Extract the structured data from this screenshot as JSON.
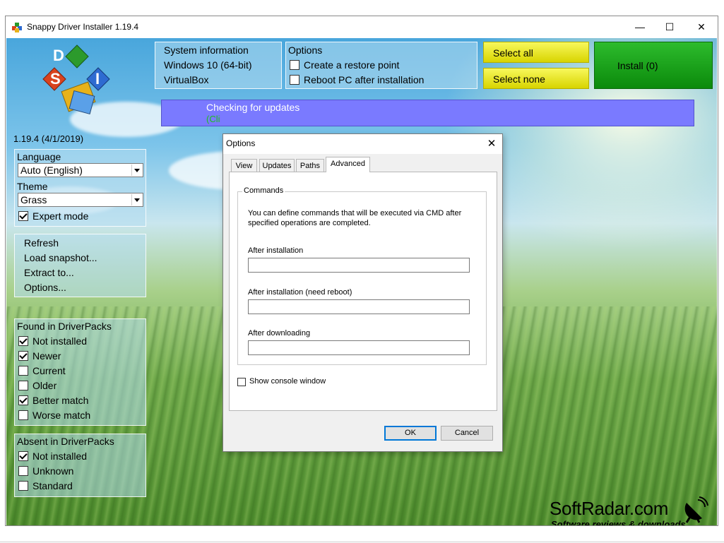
{
  "window": {
    "title": "Snappy Driver Installer 1.19.4",
    "minimize": "—",
    "maximize": "☐",
    "close": "✕"
  },
  "logo": {
    "letters": [
      "D",
      "S",
      "I"
    ],
    "version": "1.19.4 (4/1/2019)"
  },
  "settings": {
    "language_label": "Language",
    "language_value": "Auto (English)",
    "theme_label": "Theme",
    "theme_value": "Grass",
    "expert_mode": {
      "label": "Expert mode",
      "checked": true
    }
  },
  "actions": [
    "Refresh",
    "Load snapshot...",
    "Extract to...",
    "Options..."
  ],
  "found_in_driverpacks": {
    "title": "Found in DriverPacks",
    "items": [
      {
        "label": "Not installed",
        "checked": true
      },
      {
        "label": "Newer",
        "checked": true
      },
      {
        "label": "Current",
        "checked": false
      },
      {
        "label": "Older",
        "checked": false
      },
      {
        "label": "Better match",
        "checked": true
      },
      {
        "label": "Worse match",
        "checked": false
      }
    ]
  },
  "absent_in_driverpacks": {
    "title": "Absent in DriverPacks",
    "items": [
      {
        "label": "Not installed",
        "checked": true
      },
      {
        "label": "Unknown",
        "checked": false
      },
      {
        "label": "Standard",
        "checked": false
      }
    ]
  },
  "system_info": {
    "title": "System information",
    "os": "Windows 10 (64-bit)",
    "machine": "VirtualBox"
  },
  "top_options": {
    "title": "Options",
    "restore_point": "Create a restore point",
    "reboot": "Reboot PC after installation"
  },
  "buttons": {
    "select_all": "Select all",
    "select_none": "Select none",
    "install": "Install (0)"
  },
  "status": {
    "text": "Checking for updates",
    "subtext": "(Cli"
  },
  "dialog": {
    "title": "Options",
    "close": "✕",
    "tabs": [
      "View",
      "Updates",
      "Paths",
      "Advanced"
    ],
    "active_tab": "Advanced",
    "group_title": "Commands",
    "description_line1": "You can define commands that will be executed via CMD after",
    "description_line2": "specified operations are completed.",
    "fields": [
      {
        "label": "After installation",
        "value": ""
      },
      {
        "label": "After installation (need reboot)",
        "value": ""
      },
      {
        "label": "After downloading",
        "value": ""
      }
    ],
    "show_console": {
      "label": "Show console window",
      "checked": false
    },
    "ok": "OK",
    "cancel": "Cancel"
  },
  "watermark": {
    "brand": "SoftRadar.com",
    "tagline": "Software reviews & downloads"
  },
  "colors": {
    "install_green": "#0b8a0b",
    "select_yellow": "#e8e400",
    "status_blue": "#7a7aff"
  }
}
